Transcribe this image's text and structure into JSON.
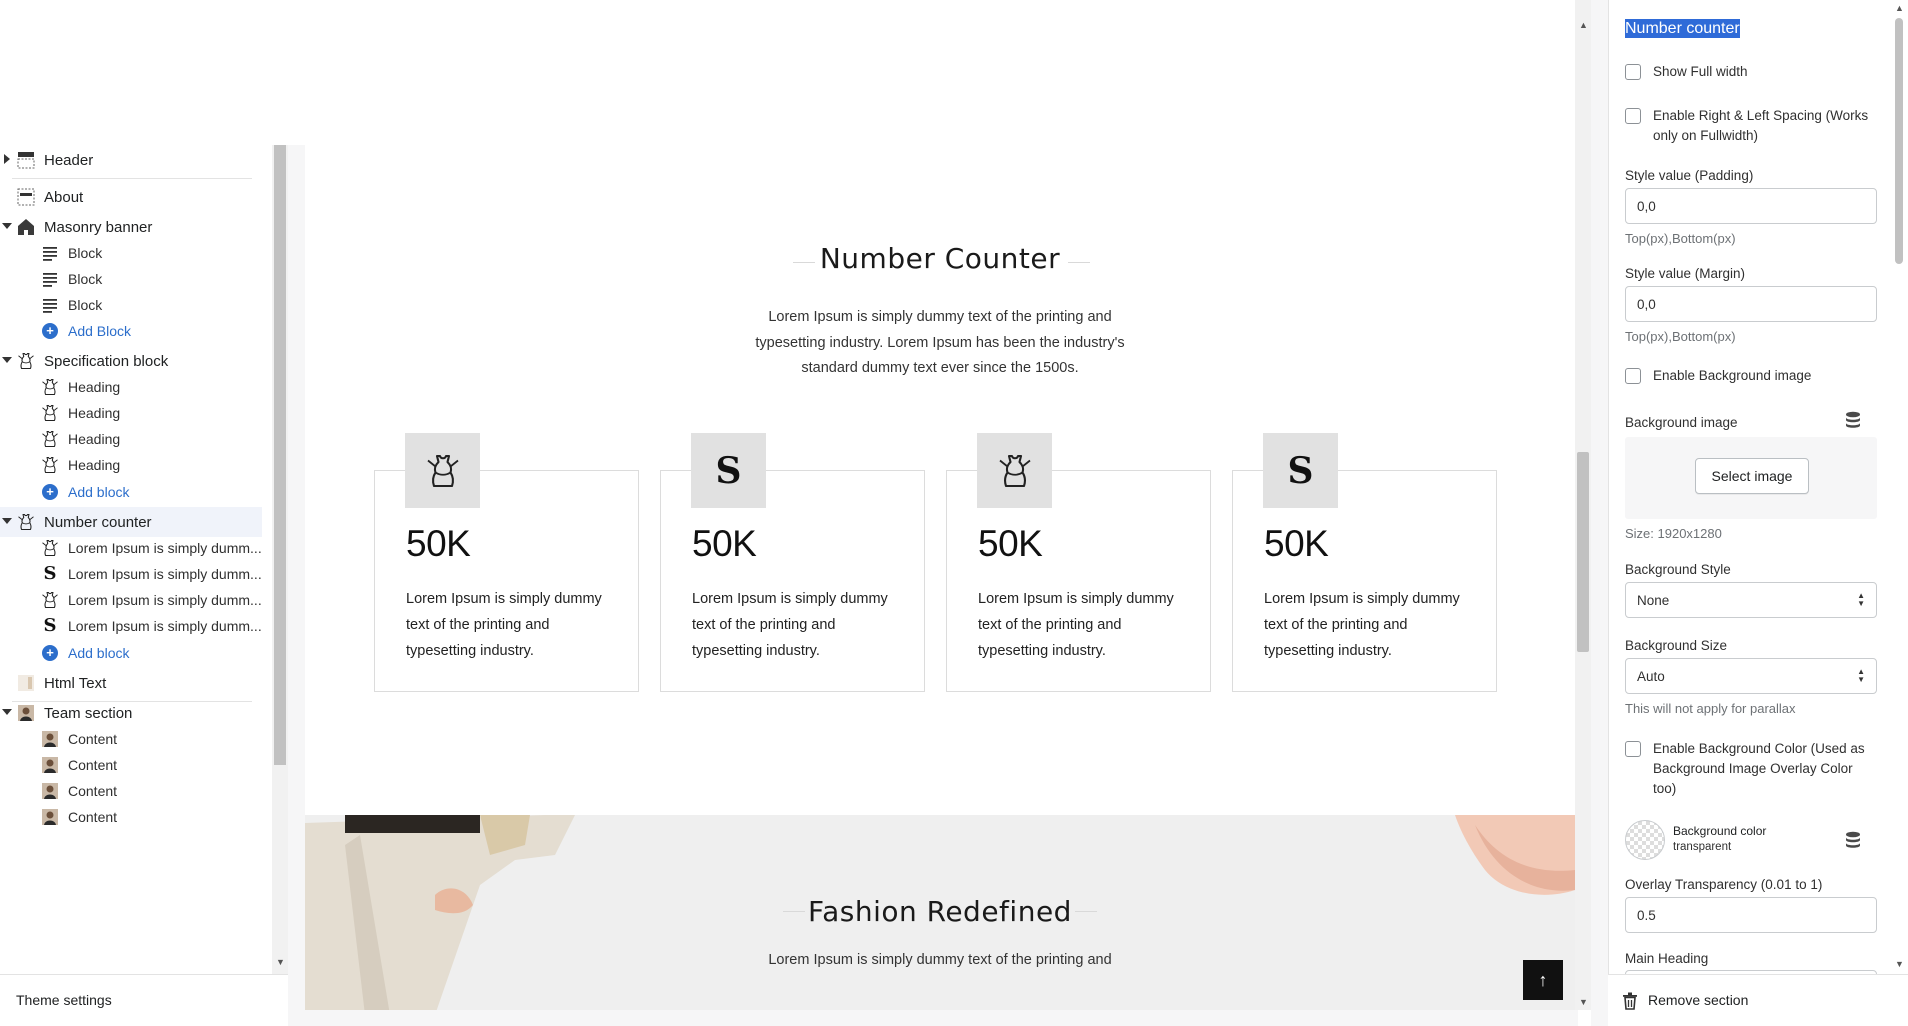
{
  "sidebar": {
    "items": [
      {
        "label": "Header",
        "level": 0,
        "caret": "right",
        "icon": "header-layout-icon"
      },
      {
        "label": "About",
        "level": 0,
        "caret": "",
        "icon": "section-layout-icon"
      },
      {
        "label": "Masonry banner",
        "level": 0,
        "caret": "down",
        "icon": "home-icon"
      },
      {
        "label": "Block",
        "level": 1,
        "icon": "text-lines-icon"
      },
      {
        "label": "Block",
        "level": 1,
        "icon": "text-lines-icon"
      },
      {
        "label": "Block",
        "level": 1,
        "icon": "text-lines-icon"
      },
      {
        "label": "Add Block",
        "level": 1,
        "icon": "plus-circle-icon",
        "add": true
      },
      {
        "label": "Specification block",
        "level": 0,
        "caret": "down",
        "icon": "dress-icon"
      },
      {
        "label": "Heading",
        "level": 1,
        "icon": "dress-icon"
      },
      {
        "label": "Heading",
        "level": 1,
        "icon": "dress-icon"
      },
      {
        "label": "Heading",
        "level": 1,
        "icon": "dress-icon"
      },
      {
        "label": "Heading",
        "level": 1,
        "icon": "dress-icon"
      },
      {
        "label": "Add block",
        "level": 1,
        "icon": "plus-circle-icon",
        "add": true
      },
      {
        "label": "Number counter",
        "level": 0,
        "caret": "down",
        "icon": "dress-icon",
        "active": true
      },
      {
        "label": "Lorem Ipsum is simply dumm...",
        "level": 1,
        "icon": "dress-icon"
      },
      {
        "label": "Lorem Ipsum is simply dumm...",
        "level": 1,
        "icon": "s-letter-icon"
      },
      {
        "label": "Lorem Ipsum is simply dumm...",
        "level": 1,
        "icon": "dress-icon"
      },
      {
        "label": "Lorem Ipsum is simply dumm...",
        "level": 1,
        "icon": "s-letter-icon"
      },
      {
        "label": "Add block",
        "level": 1,
        "icon": "plus-circle-icon",
        "add": true
      },
      {
        "label": "Html Text",
        "level": 0,
        "caret": "",
        "icon": "image-thumb-icon"
      },
      {
        "label": "Team section",
        "level": 0,
        "caret": "down",
        "icon": "photo-thumb-icon"
      },
      {
        "label": "Content",
        "level": 1,
        "icon": "photo-thumb-icon"
      },
      {
        "label": "Content",
        "level": 1,
        "icon": "photo-thumb-icon"
      },
      {
        "label": "Content",
        "level": 1,
        "icon": "photo-thumb-icon"
      },
      {
        "label": "Content",
        "level": 1,
        "icon": "photo-thumb-icon"
      }
    ],
    "theme_settings": "Theme settings"
  },
  "preview": {
    "counter_section": {
      "title": "Number Counter",
      "description_lines": [
        "Lorem Ipsum is simply dummy text of the printing and",
        "typesetting industry. Lorem Ipsum has been the industry's",
        "standard dummy text ever since the 1500s."
      ],
      "cards": [
        {
          "icon": "dress-icon",
          "number": "50K",
          "text_lines": [
            "Lorem Ipsum is simply dummy",
            "text of the printing and",
            "typesetting industry."
          ]
        },
        {
          "icon": "s-letter-icon",
          "glyph": "S",
          "number": "50K",
          "text_lines": [
            "Lorem Ipsum is simply dummy",
            "text of the printing and",
            "typesetting industry."
          ]
        },
        {
          "icon": "dress-icon",
          "number": "50K",
          "text_lines": [
            "Lorem Ipsum is simply dummy",
            "text of the printing and",
            "typesetting industry."
          ]
        },
        {
          "icon": "s-letter-icon",
          "glyph": "S",
          "number": "50K",
          "text_lines": [
            "Lorem Ipsum is simply dummy",
            "text of the printing and",
            "typesetting industry."
          ]
        }
      ]
    },
    "fashion_section": {
      "title": "Fashion Redefined",
      "description_line": "Lorem Ipsum is simply dummy text of the printing and"
    },
    "back_to_top": "↑"
  },
  "settings": {
    "section_name": "Number counter",
    "show_full_width": {
      "label": "Show Full width",
      "checked": false
    },
    "enable_spacing": {
      "label": "Enable Right & Left Spacing (Works only on Fullwidth)",
      "checked": false
    },
    "padding": {
      "label": "Style value (Padding)",
      "value": "0,0",
      "help": "Top(px),Bottom(px)"
    },
    "margin": {
      "label": "Style value (Margin)",
      "value": "0,0",
      "help": "Top(px),Bottom(px)"
    },
    "enable_bg_image": {
      "label": "Enable Background image",
      "checked": false
    },
    "bg_image": {
      "label": "Background image",
      "button": "Select image",
      "size": "Size: 1920x1280"
    },
    "bg_style": {
      "label": "Background Style",
      "value": "None"
    },
    "bg_size": {
      "label": "Background Size",
      "value": "Auto",
      "help": "This will not apply for parallax"
    },
    "enable_bg_color": {
      "label": "Enable Background Color (Used as Background Image Overlay Color too)",
      "checked": false
    },
    "bg_color": {
      "label": "Background color",
      "value": "transparent"
    },
    "overlay": {
      "label": "Overlay Transparency (0.01 to 1)",
      "value": "0.5"
    },
    "main_heading": {
      "label": "Main Heading"
    },
    "remove_section": "Remove section"
  },
  "colors": {
    "accent": "#2c6ecb",
    "highlight": "#2f6bd8",
    "card_icon_bg": "#e1e1e1"
  }
}
